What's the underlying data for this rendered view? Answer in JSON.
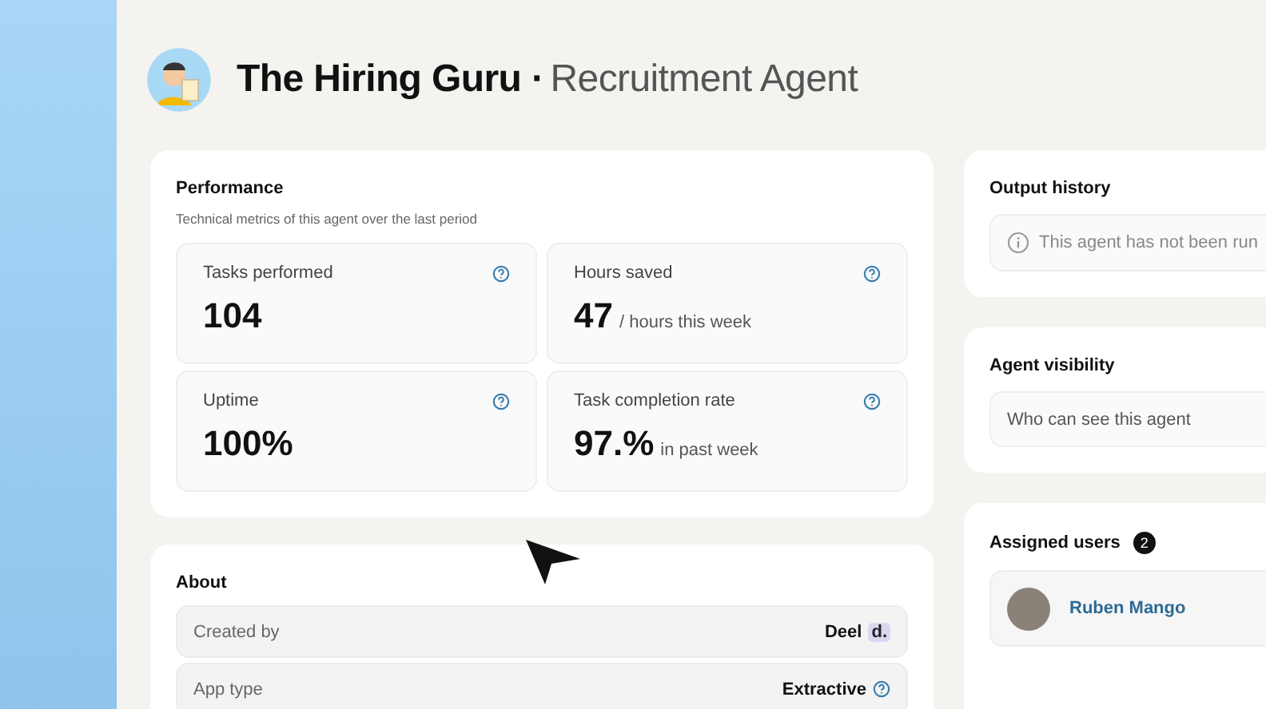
{
  "header": {
    "title": "The Hiring Guru",
    "separator": "·",
    "subtitle": "Recruitment Agent"
  },
  "performance": {
    "title": "Performance",
    "description": "Technical metrics of this agent over the last period",
    "metrics": [
      {
        "label": "Tasks performed",
        "value": "104"
      },
      {
        "label": "Hours saved",
        "value": "47",
        "note": "/ hours this week"
      },
      {
        "label": "Uptime",
        "value": "100%"
      },
      {
        "label": "Task completion rate",
        "value": "97.%",
        "note": "in past week"
      }
    ]
  },
  "about": {
    "title": "About",
    "rows": [
      {
        "label": "Created by",
        "value": "Deel",
        "kind": "logo",
        "logo": "d."
      },
      {
        "label": "App type",
        "value": "Extractive",
        "kind": "help"
      }
    ]
  },
  "output_history": {
    "title": "Output history",
    "message": "This agent has not been run"
  },
  "visibility": {
    "title": "Agent visibility",
    "placeholder": "Who can see this agent"
  },
  "assigned_users": {
    "title": "Assigned users",
    "count": "2",
    "users": [
      {
        "name": "Ruben Mango"
      }
    ]
  }
}
